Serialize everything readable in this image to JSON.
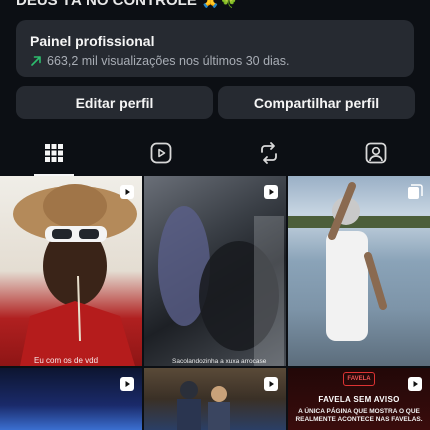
{
  "profile": {
    "bio_line": "DEUS TÁ NO CONTROLE 🙏🍀"
  },
  "professional_panel": {
    "title": "Painel profissional",
    "stats": "663,2 mil visualizações nos últimos 30 dias."
  },
  "buttons": {
    "edit": "Editar perfil",
    "share": "Compartilhar perfil"
  },
  "tabs": [
    {
      "name": "grid",
      "icon": "grid-icon",
      "active": true
    },
    {
      "name": "reels",
      "icon": "reels-icon",
      "active": false
    },
    {
      "name": "reposts",
      "icon": "repost-icon",
      "active": false
    },
    {
      "name": "tagged",
      "icon": "tagged-person-icon",
      "active": false
    }
  ],
  "posts": [
    {
      "type": "reel",
      "caption": "Eu com os de vdd"
    },
    {
      "type": "reel",
      "caption": "Sacolandozinha a xuxa arrocase"
    },
    {
      "type": "carousel",
      "caption": ""
    },
    {
      "type": "reel",
      "caption": ""
    },
    {
      "type": "reel",
      "caption": ""
    },
    {
      "type": "reel",
      "title": "FAVELA SEM AVISO",
      "text": "A ÚNICA PÁGINA QUE MOSTRA O QUE REALMENTE ACONTECE NAS FAVELAS.",
      "logo": "FAVELA"
    }
  ],
  "colors": {
    "background": "#0c0f14",
    "panel": "#262a31",
    "trend": "#2dbd6e"
  }
}
